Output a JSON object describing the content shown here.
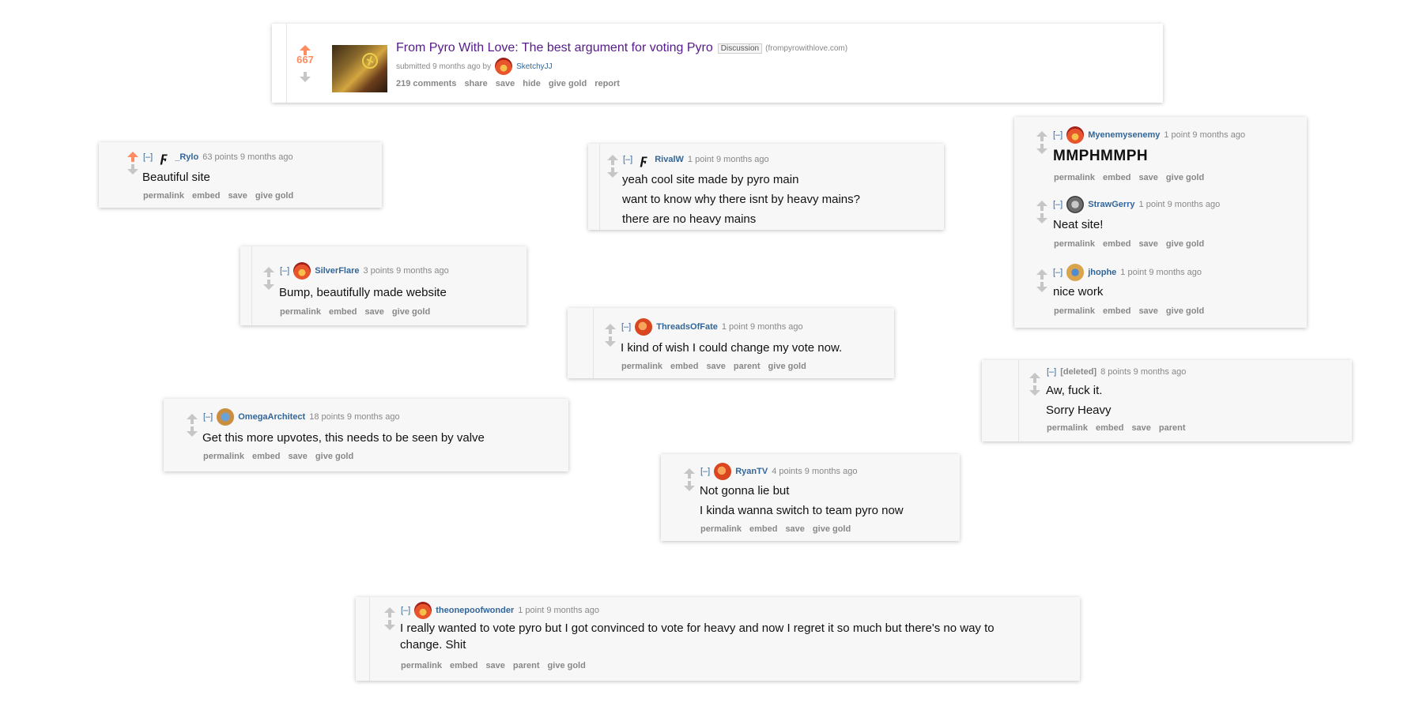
{
  "post": {
    "score": "667",
    "title": "From Pyro With Love: The best argument for voting Pyro",
    "flair": "Discussion",
    "domain": "(frompyrowithlove.com)",
    "submitted": "submitted 9 months ago by",
    "author": "SketchyJJ",
    "buttons": [
      "219 comments",
      "share",
      "save",
      "hide",
      "give gold",
      "report"
    ]
  },
  "comments": {
    "rylo": {
      "author": "_Rylo",
      "meta": "63 points 9 months ago",
      "lines": [
        "Beautiful site"
      ],
      "buttons": [
        "permalink",
        "embed",
        "save",
        "give gold"
      ]
    },
    "rivalw": {
      "author": "RivalW",
      "meta": "1 point 9 months ago",
      "lines": [
        "yeah cool site made by pyro main",
        "want to know why there isnt by heavy mains?",
        "there are no heavy mains"
      ]
    },
    "myen": {
      "author": "Myenemysenemy",
      "meta": "1 point 9 months ago",
      "lines": [
        "MMPHMMPH"
      ],
      "buttons": [
        "permalink",
        "embed",
        "save",
        "give gold"
      ]
    },
    "straw": {
      "author": "StrawGerry",
      "meta": "1 point 9 months ago",
      "lines": [
        "Neat site!"
      ],
      "buttons": [
        "permalink",
        "embed",
        "save",
        "give gold"
      ]
    },
    "jhophe": {
      "author": "jhophe",
      "meta": "1 point 9 months ago",
      "lines": [
        "nice work"
      ],
      "buttons": [
        "permalink",
        "embed",
        "save",
        "give gold"
      ]
    },
    "silver": {
      "author": "SilverFlare",
      "meta": "3 points 9 months ago",
      "lines": [
        "Bump, beautifully made website"
      ],
      "buttons": [
        "permalink",
        "embed",
        "save",
        "give gold"
      ]
    },
    "threads": {
      "author": "ThreadsOfFate",
      "meta": "1 point 9 months ago",
      "lines": [
        "I kind of wish I could change my vote now."
      ],
      "buttons": [
        "permalink",
        "embed",
        "save",
        "parent",
        "give gold"
      ]
    },
    "deleted": {
      "author": "[deleted]",
      "meta": "8 points 9 months ago",
      "lines": [
        "Aw, fuck it.",
        "Sorry Heavy"
      ],
      "buttons": [
        "permalink",
        "embed",
        "save",
        "parent"
      ]
    },
    "omega": {
      "author": "OmegaArchitect",
      "meta": "18 points 9 months ago",
      "lines": [
        "Get this more upvotes, this needs to be seen by valve"
      ],
      "buttons": [
        "permalink",
        "embed",
        "save",
        "give gold"
      ]
    },
    "ryan": {
      "author": "RyanTV",
      "meta": "4 points 9 months ago",
      "lines": [
        "Not gonna lie but",
        "I kinda wanna switch to team pyro now"
      ],
      "buttons": [
        "permalink",
        "embed",
        "save",
        "give gold"
      ]
    },
    "theone": {
      "author": "theonepoofwonder",
      "meta": "1 point 9 months ago",
      "lines": [
        "I really wanted to vote pyro but I got convinced to vote for heavy and now I regret it so much but there's no way to",
        "change. Shit"
      ],
      "buttons": [
        "permalink",
        "embed",
        "save",
        "parent",
        "give gold"
      ]
    }
  },
  "collapse_label": "[–]",
  "bolt_glyph": "ϝ"
}
